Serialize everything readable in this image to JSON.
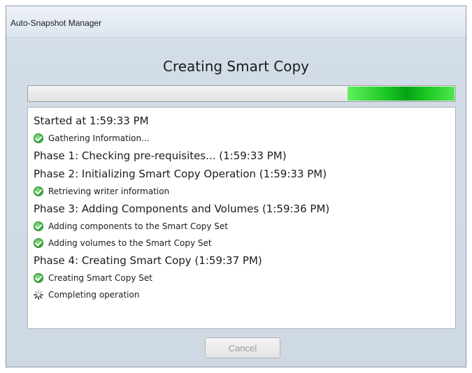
{
  "window": {
    "title": "Auto-Snapshot Manager"
  },
  "dialog": {
    "heading": "Creating Smart Copy",
    "progress": 0.25,
    "cancel_label": "Cancel",
    "cancel_enabled": false
  },
  "log": [
    {
      "kind": "phase",
      "icon": null,
      "text": "Started at 1:59:33 PM"
    },
    {
      "kind": "step",
      "icon": "check-icon",
      "text": "Gathering Information..."
    },
    {
      "kind": "phase",
      "icon": null,
      "text": "Phase 1: Checking pre-requisites... (1:59:33 PM)"
    },
    {
      "kind": "phase",
      "icon": null,
      "text": "Phase 2: Initializing Smart Copy Operation (1:59:33 PM)"
    },
    {
      "kind": "step",
      "icon": "check-icon",
      "text": "Retrieving writer information"
    },
    {
      "kind": "phase",
      "icon": null,
      "text": "Phase 3: Adding Components and Volumes (1:59:36 PM)"
    },
    {
      "kind": "step",
      "icon": "check-icon",
      "text": "Adding components to the Smart Copy Set"
    },
    {
      "kind": "step",
      "icon": "check-icon",
      "text": "Adding volumes to the Smart Copy Set"
    },
    {
      "kind": "phase",
      "icon": null,
      "text": "Phase 4: Creating Smart Copy (1:59:37 PM)"
    },
    {
      "kind": "step",
      "icon": "check-icon",
      "text": "Creating Smart Copy Set"
    },
    {
      "kind": "step",
      "icon": "spinner-icon",
      "text": "Completing operation"
    }
  ],
  "colors": {
    "progress_green": "#1ec926",
    "check_green": "#3cae3a"
  }
}
